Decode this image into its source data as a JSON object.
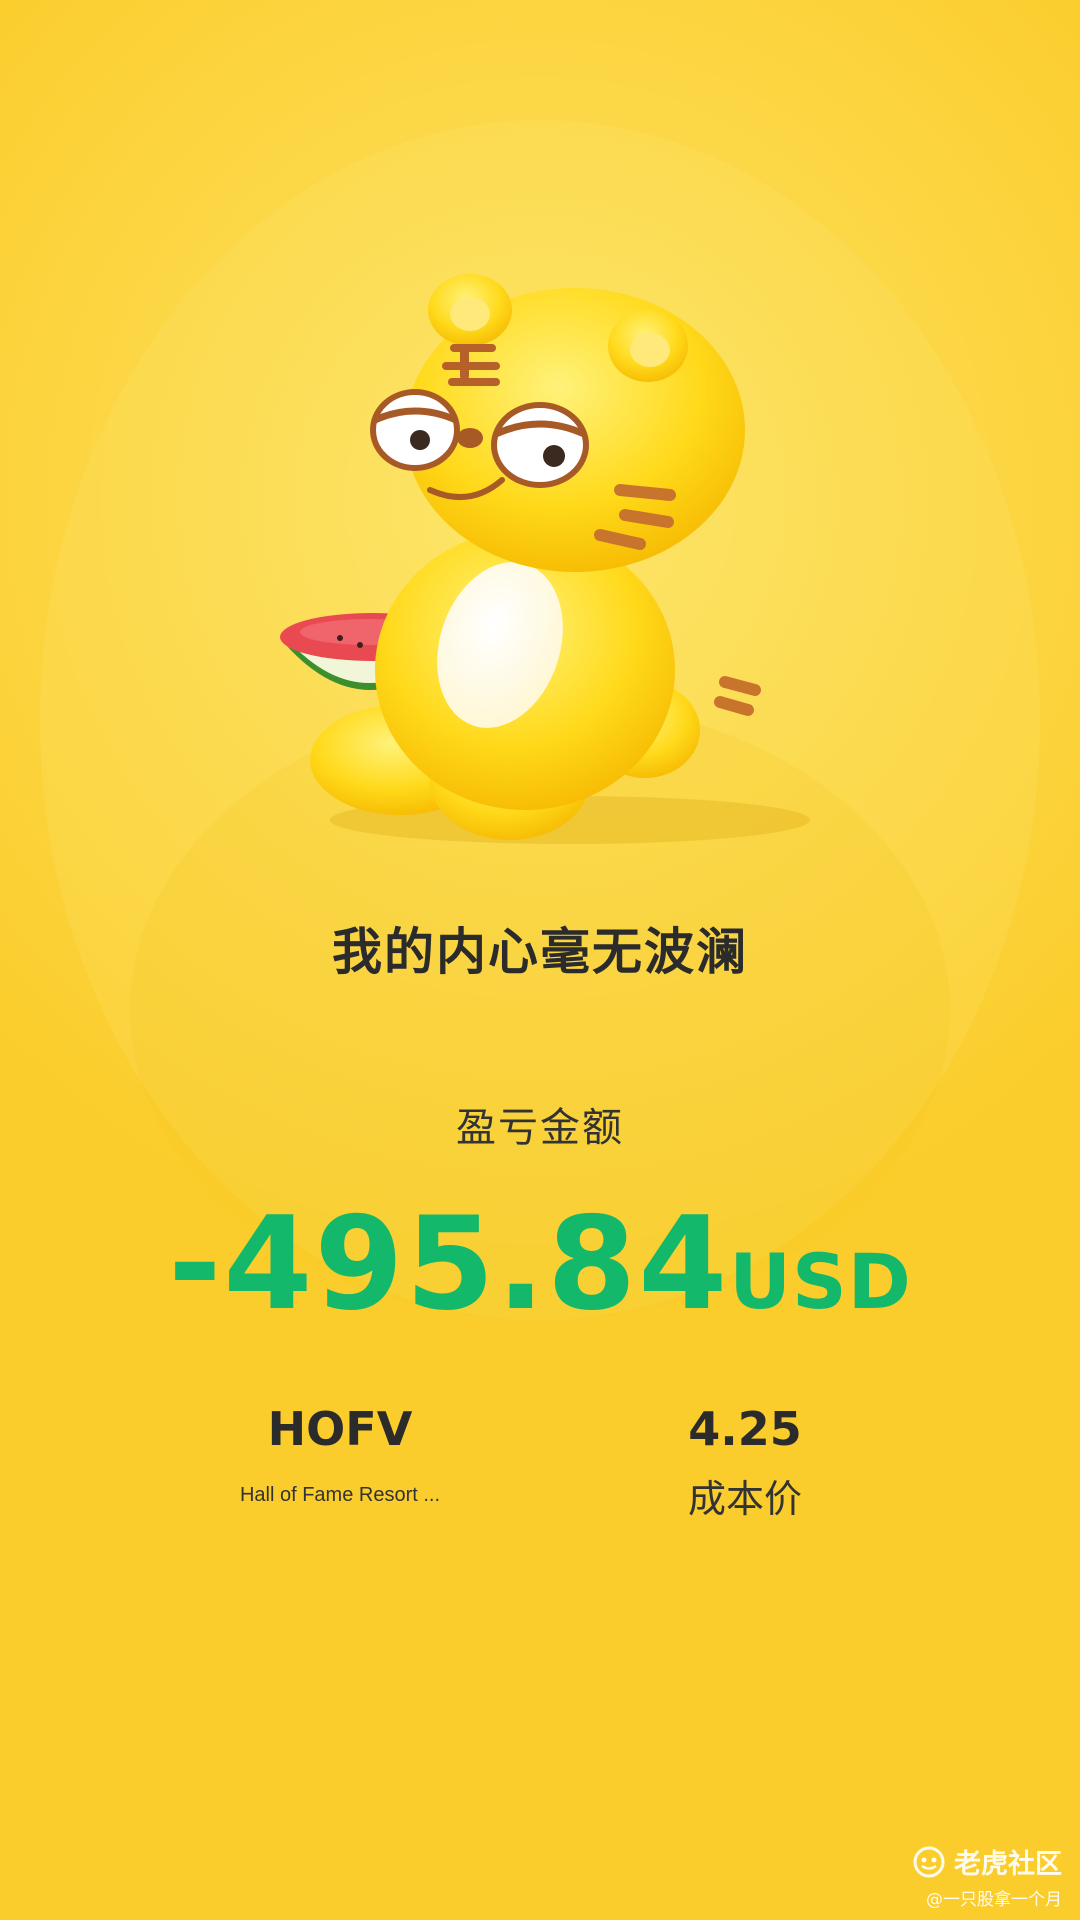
{
  "headline": "我的内心毫无波澜",
  "pnl": {
    "label": "盈亏金额",
    "value": "-495.84",
    "currency": "USD"
  },
  "stock": {
    "ticker": "HOFV",
    "name": "Hall of Fame Resort ..."
  },
  "cost": {
    "value": "4.25",
    "label": "成本价"
  },
  "watermark": {
    "brand": "老虎社区",
    "handle": "@一只股拿一个月"
  },
  "colors": {
    "background": "#fbcd2c",
    "loss_green": "#14b86b",
    "text_dark": "#2b2b2b"
  },
  "icons": {
    "mascot": "tiger-mascot-with-watermelon",
    "brand": "tiger-logo-icon"
  }
}
